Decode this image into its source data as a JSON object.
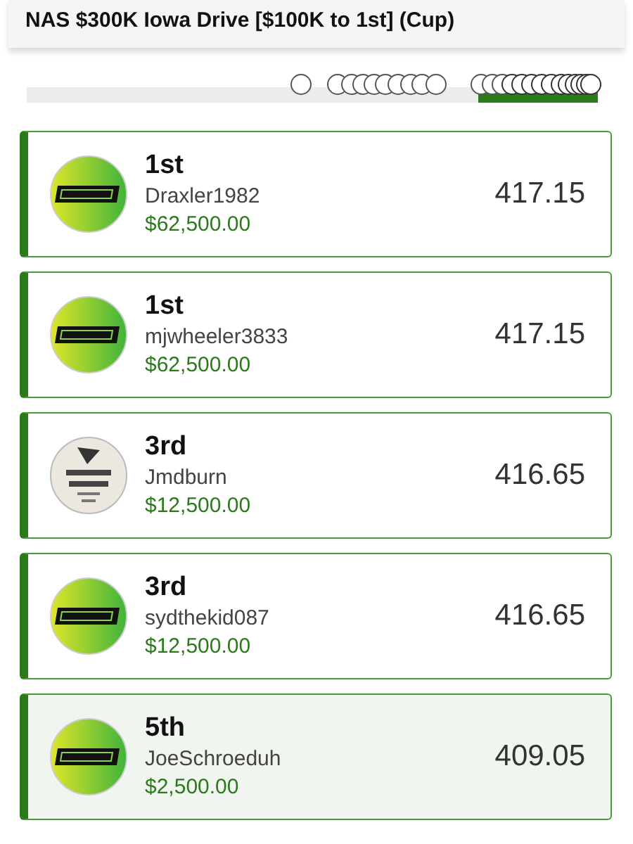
{
  "title": "NAS $300K Iowa Drive [$100K to 1st] (Cup)",
  "progress": {
    "level": 0.21
  },
  "entries": [
    {
      "rank": "1st",
      "name": "Draxler1982",
      "prize": "$62,500.00",
      "score": "417.15",
      "avatar": {
        "kind": "sg"
      },
      "selected": false
    },
    {
      "rank": "1st",
      "name": "mjwheeler3833",
      "prize": "$62,500.00",
      "score": "417.15",
      "avatar": {
        "kind": "sg"
      },
      "selected": false
    },
    {
      "rank": "3rd",
      "name": "Jmdburn",
      "prize": "$12,500.00",
      "score": "416.65",
      "avatar": {
        "kind": "badge"
      },
      "selected": false
    },
    {
      "rank": "3rd",
      "name": "sydthekid087",
      "prize": "$12,500.00",
      "score": "416.65",
      "avatar": {
        "kind": "sg"
      },
      "selected": false
    },
    {
      "rank": "5th",
      "name": "JoeSchroeduh",
      "prize": "$2,500.00",
      "score": "409.05",
      "avatar": {
        "kind": "sg"
      },
      "selected": true
    }
  ]
}
